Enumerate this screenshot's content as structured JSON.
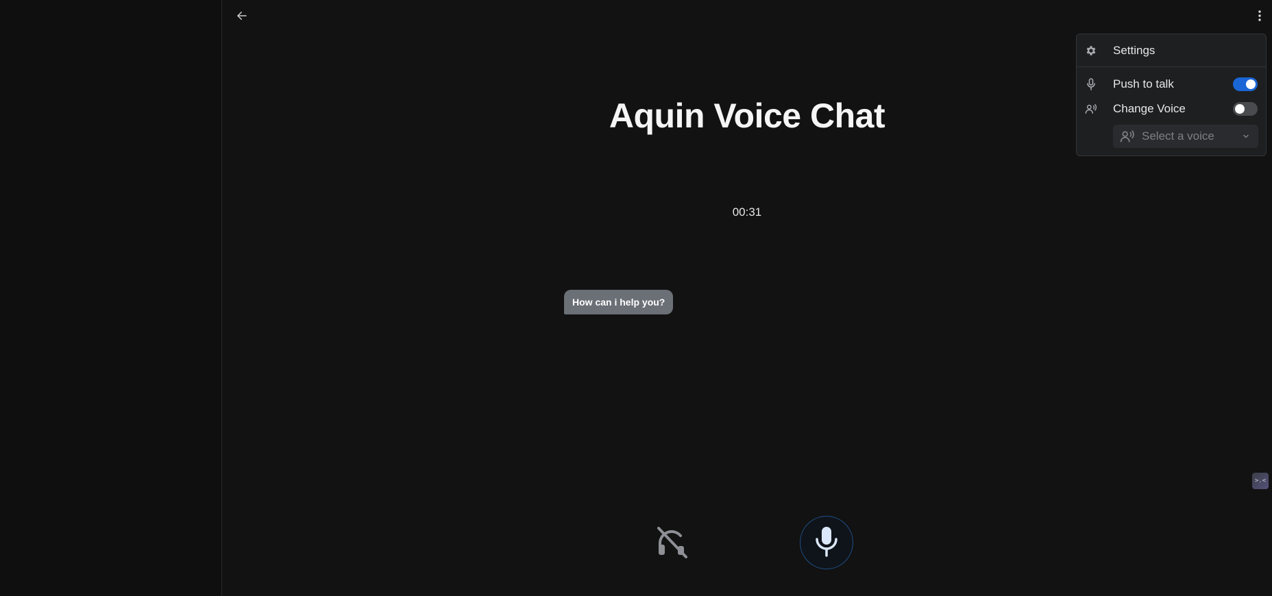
{
  "app": {
    "title": "Aquin Voice Chat",
    "timer": "00:31"
  },
  "messages": [
    {
      "role": "assistant",
      "text": "How can i help you?"
    }
  ],
  "settings_menu": {
    "header_label": "Settings",
    "push_to_talk": {
      "label": "Push to talk",
      "enabled": true
    },
    "change_voice": {
      "label": "Change Voice",
      "enabled": false
    },
    "voice_select": {
      "placeholder": "Select a voice"
    }
  },
  "icons": {
    "back": "arrow-left-icon",
    "menu": "more-vertical-icon",
    "settings": "gear-icon",
    "push_to_talk": "microphone-icon",
    "change_voice": "speaker-voice-icon",
    "deafen": "headphones-off-icon",
    "mic": "microphone-icon",
    "chevron": "chevron-down-icon"
  },
  "colors": {
    "background": "#121212",
    "accent": "#1a66d6",
    "bubble": "#6b6f76",
    "menu_bg": "#1e1f21"
  }
}
